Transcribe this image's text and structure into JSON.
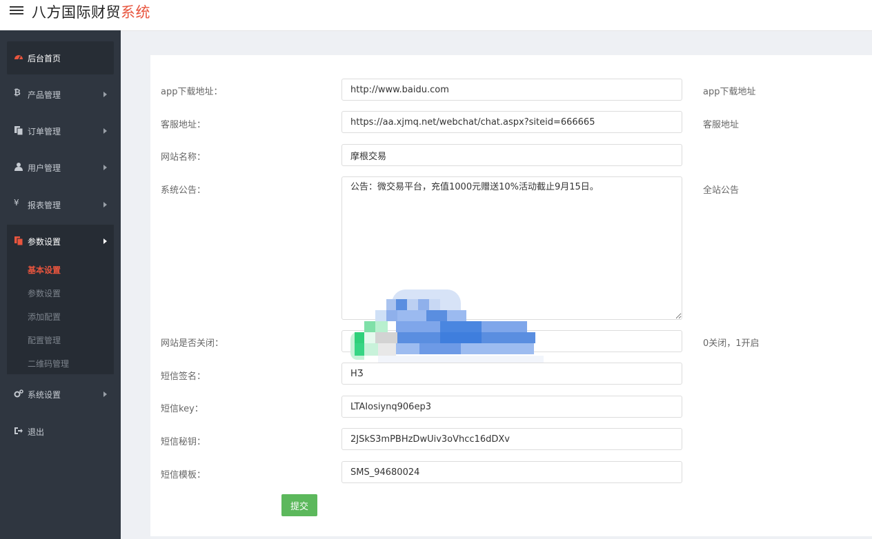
{
  "header": {
    "brand_main": "八方国际财贸",
    "brand_accent": "系统",
    "accent_color": "#e8553e"
  },
  "sidebar": {
    "items": [
      {
        "label": "后台首页",
        "icon": "dashboard-icon"
      },
      {
        "label": "产品管理",
        "icon": "bitcoin-icon"
      },
      {
        "label": "订单管理",
        "icon": "copy-icon"
      },
      {
        "label": "用户管理",
        "icon": "user-icon"
      },
      {
        "label": "报表管理",
        "icon": "yen-icon"
      },
      {
        "label": "参数设置",
        "icon": "copy-icon"
      },
      {
        "label": "系统设置",
        "icon": "gears-icon"
      },
      {
        "label": "退出",
        "icon": "sign-out-icon"
      }
    ],
    "submenu": [
      "基本设置",
      "参数设置",
      "添加配置",
      "配置管理",
      "二维码管理"
    ]
  },
  "form": {
    "rows": [
      {
        "label": "app下载地址：",
        "value": "http://www.baidu.com",
        "hint": "app下载地址"
      },
      {
        "label": "客服地址：",
        "value": "https://aa.xjmq.net/webchat/chat.aspx?siteid=666665",
        "hint": "客服地址"
      },
      {
        "label": "网站名称：",
        "value": "摩根交易",
        "hint": ""
      },
      {
        "label": "系统公告：",
        "value": "公告：微交易平台，充值1000元赠送10%活动截止9月15日。",
        "hint": "全站公告"
      },
      {
        "label": "网站是否关闭：",
        "value": "",
        "hint": "0关闭，1开启"
      },
      {
        "label": "短信签名：",
        "value": "HƷ",
        "hint": ""
      },
      {
        "label": "短信key：",
        "value": "LTAIosiynq906ep3",
        "hint": ""
      },
      {
        "label": "短信秘钥：",
        "value": "2JSkS3mPBHzDwUiv3oVhcc16dDXv",
        "hint": ""
      },
      {
        "label": "短信模板：",
        "value": "SMS_94680024",
        "hint": ""
      }
    ],
    "submit_label": "提交",
    "submit_color": "#5cb85c"
  }
}
